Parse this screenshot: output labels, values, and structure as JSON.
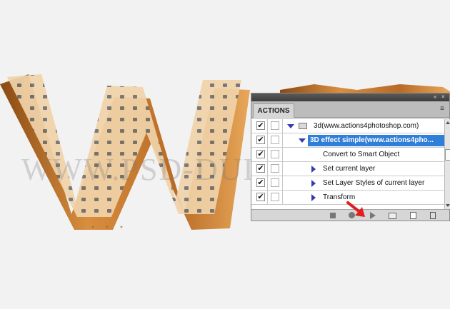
{
  "panel": {
    "tab_label": "ACTIONS",
    "menu_icon": "panel-menu-icon",
    "rows": [
      {
        "checked": true,
        "label": "3d(www.actions4photoshop.com)",
        "type": "set",
        "expanded": true,
        "selected": false
      },
      {
        "checked": true,
        "label": "3D effect simple(www.actions4pho...",
        "type": "action",
        "expanded": true,
        "selected": true
      },
      {
        "checked": true,
        "label": "Convert to Smart Object",
        "type": "step",
        "expanded": false,
        "selected": false
      },
      {
        "checked": true,
        "label": "Set current layer",
        "type": "step",
        "expanded": false,
        "selected": false
      },
      {
        "checked": true,
        "label": "Set Layer Styles of current layer",
        "type": "step",
        "expanded": false,
        "selected": false
      },
      {
        "checked": true,
        "label": "Transform",
        "type": "step",
        "expanded": false,
        "selected": false
      }
    ],
    "check_glyph": "✔",
    "bottom_buttons": [
      "stop-icon",
      "record-icon",
      "play-icon",
      "new-set-icon",
      "new-action-icon",
      "delete-icon"
    ]
  },
  "watermark": "WWW.PSD-DUDE.COM",
  "colors": {
    "selected": "#2f7fd8",
    "arrow": "#e02020",
    "wood_light": "#f1d4a8",
    "wood_dark": "#b86a26"
  }
}
